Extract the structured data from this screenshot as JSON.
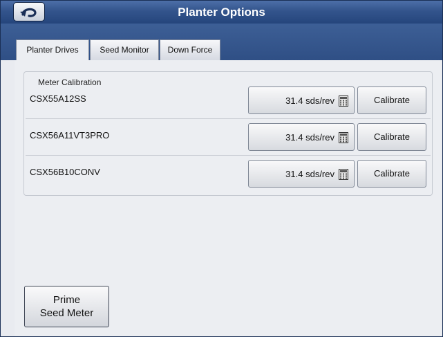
{
  "window": {
    "title": "Planter Options"
  },
  "tabs": [
    {
      "label": "Planter Drives",
      "active": true
    },
    {
      "label": "Seed Monitor",
      "active": false
    },
    {
      "label": "Down Force",
      "active": false
    }
  ],
  "meter_calibration": {
    "group_label": "Meter Calibration",
    "rows": [
      {
        "name": "CSX55A12SS",
        "value": "31.4 sds/rev",
        "button_label": "Calibrate"
      },
      {
        "name": "CSX56A11VT3PRO",
        "value": "31.4 sds/rev",
        "button_label": "Calibrate"
      },
      {
        "name": "CSX56B10CONV",
        "value": "31.4 sds/rev",
        "button_label": "Calibrate"
      }
    ]
  },
  "prime_button": {
    "line1": "Prime",
    "line2": "Seed Meter"
  },
  "icons": {
    "back": "back-arrow-icon",
    "calculator": "calculator-icon"
  },
  "colors": {
    "titlebar": "#33548c",
    "background": "#eceef2",
    "title_text": "#ffffff"
  }
}
